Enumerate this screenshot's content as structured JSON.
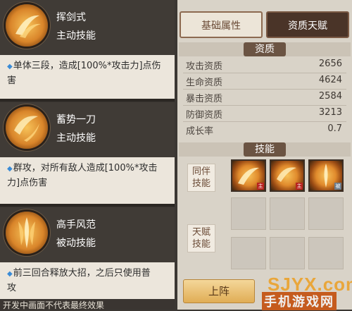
{
  "skills": [
    {
      "name": "挥剑式",
      "type": "主动技能",
      "desc_line1": "单体三段，造成[100%*攻击力]点伤",
      "desc_line2": "害"
    },
    {
      "name": "蓄势一刀",
      "type": "主动技能",
      "desc_line1": "群攻，对所有敌人造成[100%*攻击",
      "desc_line2": "力]点伤害"
    },
    {
      "name": "高手风范",
      "type": "被动技能",
      "desc_line1": "前三回合释放大招，之后只使用普",
      "desc_line2": "攻"
    }
  ],
  "footer_note": "开发中画面不代表最终效果",
  "tabs": {
    "basic": "基础属性",
    "talent": "资质天赋"
  },
  "aptitude": {
    "title": "资质",
    "rows": [
      {
        "label": "攻击资质",
        "value": "2656"
      },
      {
        "label": "生命资质",
        "value": "4624"
      },
      {
        "label": "暴击资质",
        "value": "2584"
      },
      {
        "label": "防御资质",
        "value": "3213"
      },
      {
        "label": "成长率",
        "value": "0.7"
      }
    ]
  },
  "skills_panel": {
    "title": "技能",
    "companion_label_1": "同伴",
    "companion_label_2": "技能",
    "talent_label_1": "天赋",
    "talent_label_2": "技能",
    "badges": [
      "主",
      "主",
      "被"
    ]
  },
  "deploy_button": "上阵",
  "watermark": {
    "top": "SJYX.com",
    "bottom": "手机游戏网"
  }
}
